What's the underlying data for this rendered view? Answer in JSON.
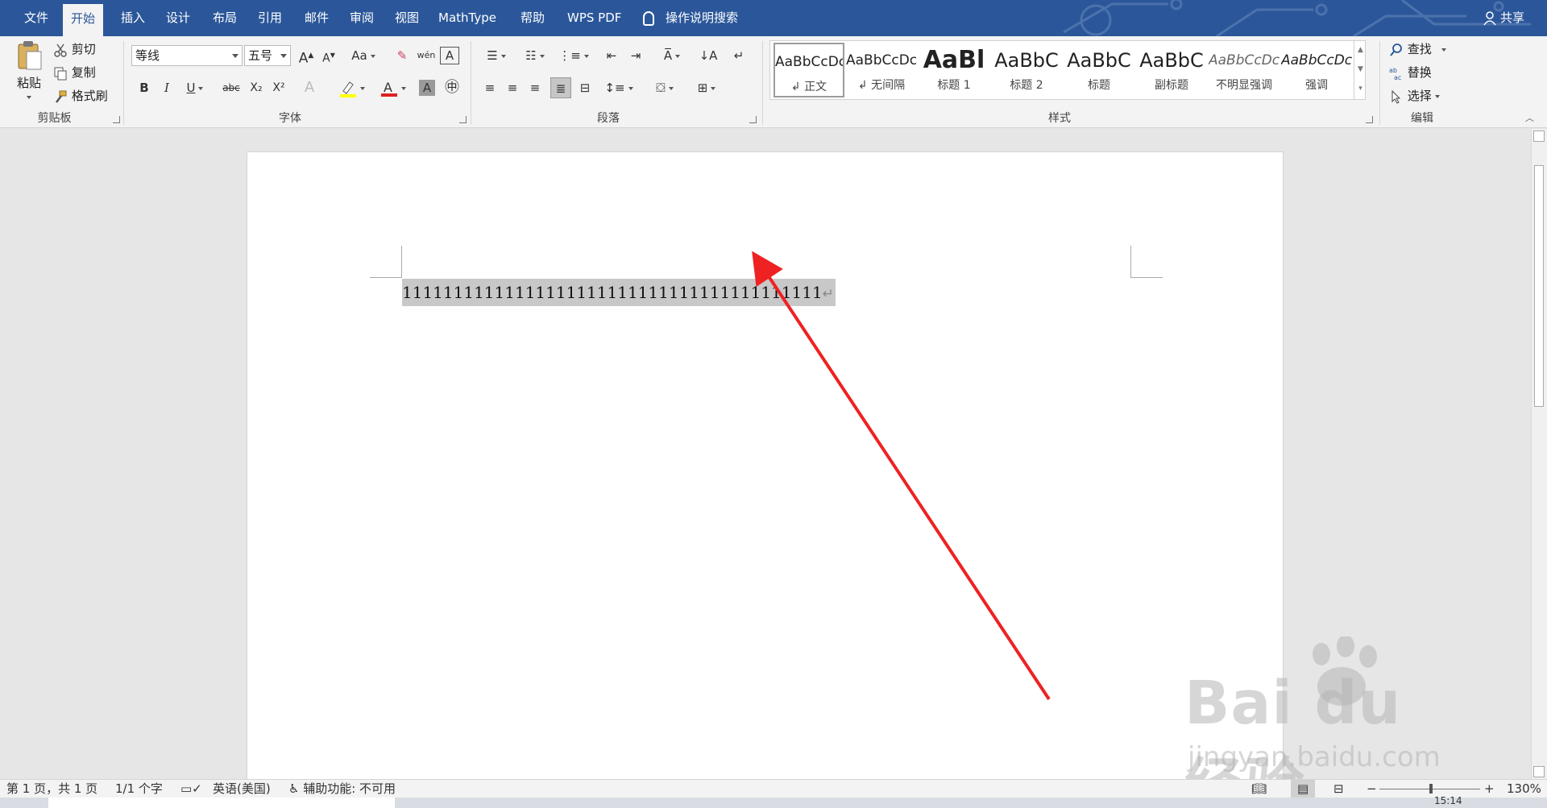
{
  "tabs": [
    {
      "label": "文件",
      "active": false
    },
    {
      "label": "开始",
      "active": true
    },
    {
      "label": "插入",
      "active": false
    },
    {
      "label": "设计",
      "active": false
    },
    {
      "label": "布局",
      "active": false
    },
    {
      "label": "引用",
      "active": false
    },
    {
      "label": "邮件",
      "active": false
    },
    {
      "label": "审阅",
      "active": false
    },
    {
      "label": "视图",
      "active": false
    },
    {
      "label": "MathType",
      "active": false
    },
    {
      "label": "帮助",
      "active": false
    },
    {
      "label": "WPS PDF",
      "active": false
    }
  ],
  "tell_me": "操作说明搜索",
  "share": "共享",
  "clipboard": {
    "paste": "粘贴",
    "cut": "剪切",
    "copy": "复制",
    "format_painter": "格式刷",
    "label": "剪贴板"
  },
  "font": {
    "font_name": "等线",
    "font_size": "五号",
    "label": "字体",
    "bold": "B",
    "italic": "I",
    "underline": "U",
    "strike": "abc",
    "subscript": "X₂",
    "superscript": "X²",
    "grow": "A",
    "shrink": "A",
    "case": "Aa",
    "char_border": "A",
    "font_color_hex": "#e02020",
    "highlight_hex": "#ffff00"
  },
  "paragraph": {
    "label": "段落"
  },
  "styles": {
    "label": "样式",
    "items": [
      {
        "sample": "AaBbCcDc",
        "name": "↲ 正文",
        "selected": true
      },
      {
        "sample": "AaBbCcDc",
        "name": "↲ 无间隔",
        "selected": false
      },
      {
        "sample": "AaBl",
        "name": "标题 1",
        "selected": false
      },
      {
        "sample": "AaBbC",
        "name": "标题 2",
        "selected": false
      },
      {
        "sample": "AaBbC",
        "name": "标题",
        "selected": false
      },
      {
        "sample": "AaBbC",
        "name": "副标题",
        "selected": false
      },
      {
        "sample": "AaBbCcDc",
        "name": "不明显强调",
        "selected": false
      },
      {
        "sample": "AaBbCcDc",
        "name": "强调",
        "selected": false
      }
    ]
  },
  "editing": {
    "find": "查找",
    "replace": "替换",
    "select": "选择",
    "label": "编辑"
  },
  "document": {
    "text": "11111111111111111111111111111111111111111",
    "para_mark": "↵"
  },
  "status": {
    "page": "第 1 页，共 1 页",
    "words": "1/1 个字",
    "language": "英语(美国)",
    "accessibility": "辅助功能: 不可用",
    "zoom": "130%",
    "time": "15:14"
  },
  "watermark": {
    "brand": "Bai  du 经验",
    "url": "jingyan.baidu.com"
  },
  "colors": {
    "ribbon_blue": "#2b579a",
    "arrow_red": "#ee2222",
    "selection_gray": "#c8c8c8"
  }
}
